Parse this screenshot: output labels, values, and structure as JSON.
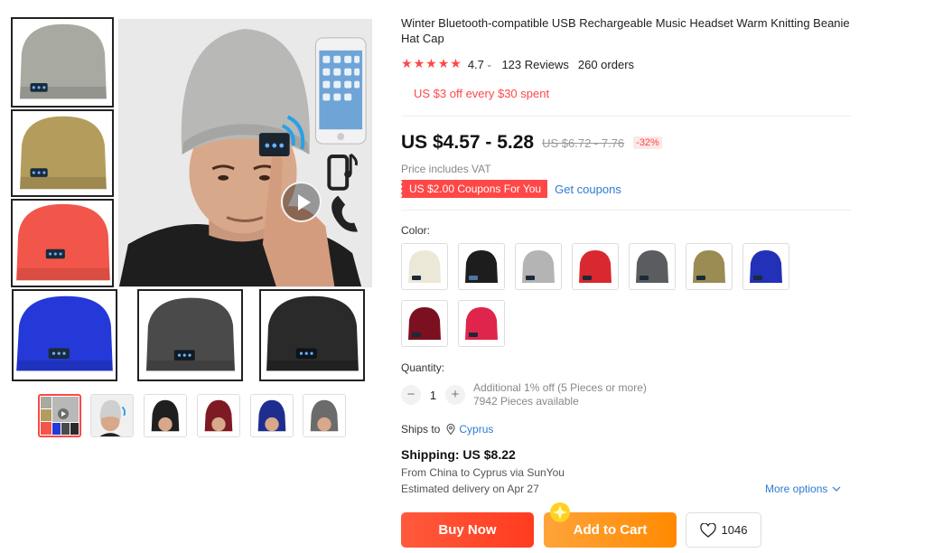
{
  "product": {
    "title": "Winter Bluetooth-compatible USB Rechargeable Music Headset Warm Knitting Beanie Hat Cap",
    "rating": "4.7",
    "reviews": "123 Reviews",
    "orders": "260 orders",
    "promo": "US $3 off every $30 spent"
  },
  "pricing": {
    "price": "US $4.57 - 5.28",
    "old_price": "US $6.72 - 7.76",
    "discount": "-32%",
    "vat_note": "Price includes VAT",
    "coupon_label": "US $2.00 Coupons For You",
    "get_coupons": "Get coupons"
  },
  "options": {
    "color_label": "Color:",
    "swatches": [
      "cream",
      "black",
      "light-gray",
      "red",
      "dark-gray",
      "khaki",
      "blue",
      "burgundy",
      "rose"
    ],
    "swatch_colors": [
      "#ece8d8",
      "#1d1d1d",
      "#b4b4b4",
      "#d9282f",
      "#5a5c60",
      "#9a8c52",
      "#2330b8",
      "#7a1020",
      "#e0254c"
    ]
  },
  "gallery": {
    "left_thumbs": [
      "#a8a9a1",
      "#b49d5c",
      "#f2564a"
    ],
    "bottom_thumbs": [
      "#2439d8",
      "#4a4a4a",
      "#2a2a2a"
    ],
    "main_hat_color": "#b8b8b6",
    "mini_thumbs": [
      "collage",
      "#cfcfcf",
      "#1f1f1f",
      "#7d1a24",
      "#1e2e8f",
      "#6b6b6b"
    ]
  },
  "quantity": {
    "label": "Quantity:",
    "minus": "−",
    "value": "1",
    "plus": "+",
    "note_line1": "Additional 1% off (5 Pieces or more)",
    "note_line2": "7942 Pieces available"
  },
  "shipping": {
    "ships_to_label": "Ships to",
    "ships_to_location": "Cyprus",
    "cost": "Shipping: US $8.22",
    "from_line": "From China to Cyprus via SunYou",
    "eta": "Estimated delivery on Apr 27",
    "more_options": "More options"
  },
  "actions": {
    "buy_now": "Buy Now",
    "add_to_cart": "Add to Cart",
    "wishlist_count": "1046"
  },
  "colors": {
    "accent_red": "#ff4747",
    "link_blue": "#2e7bd1",
    "buy_now": "#ff4422",
    "add_to_cart": "#ff9a1f"
  }
}
